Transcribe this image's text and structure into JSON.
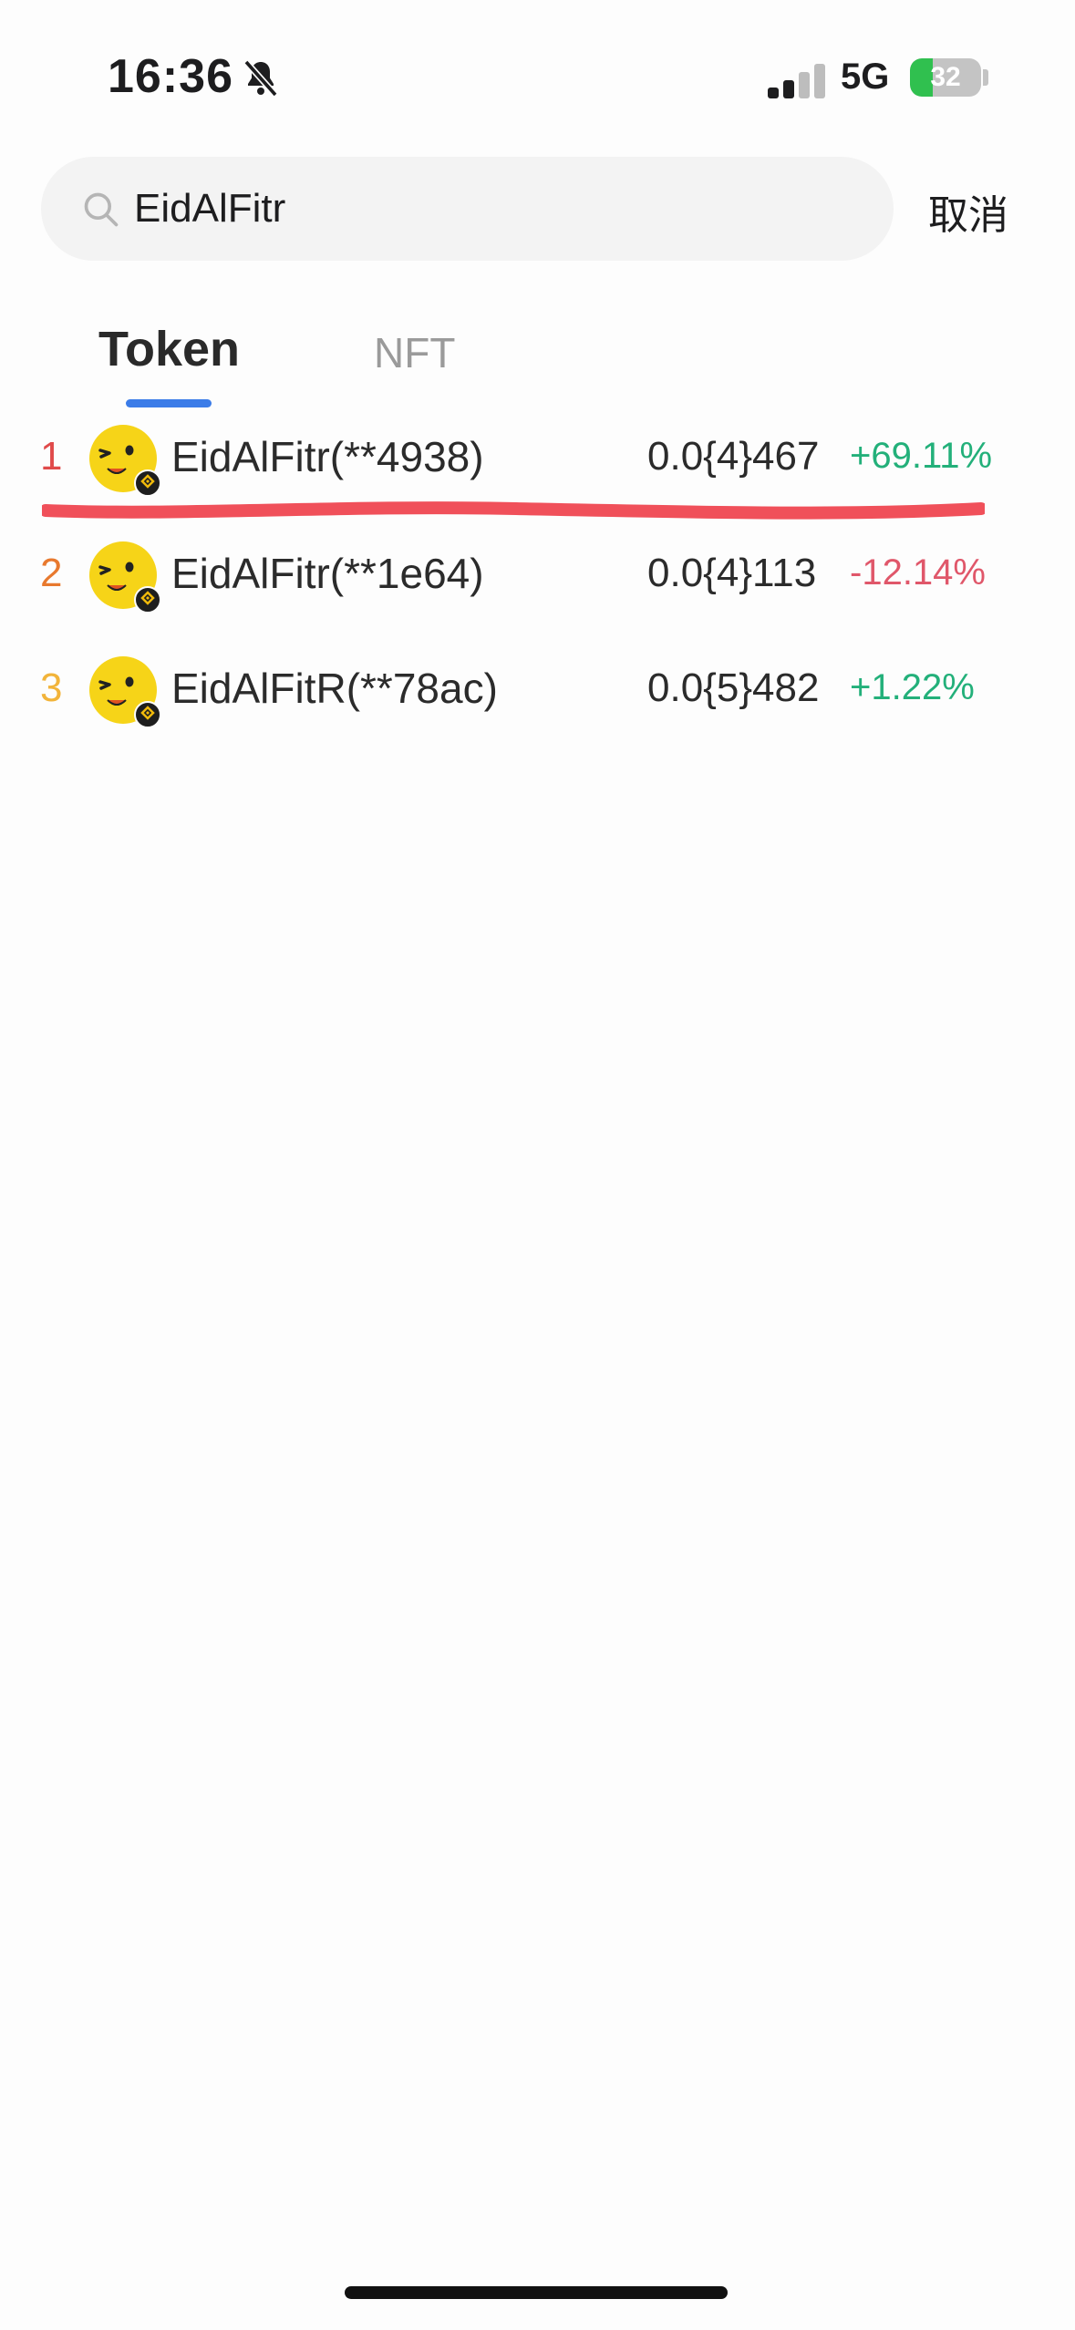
{
  "status_bar": {
    "time": "16:36",
    "network": "5G",
    "battery": "32",
    "battery_level_percent": 32,
    "silent_mode_icon": "bell-slash-icon"
  },
  "search": {
    "value": "EidAlFitr",
    "cancel_label": "取消"
  },
  "tabs": [
    {
      "label": "Token",
      "active": true
    },
    {
      "label": "NFT",
      "active": false
    }
  ],
  "results": [
    {
      "rank": "1",
      "rank_color": "#e04a4a",
      "name": "EidAlFitr(**4938)",
      "price": "0.0{4}467",
      "change": "+69.11%",
      "change_color": "#23b07a",
      "highlighted": true
    },
    {
      "rank": "2",
      "rank_color": "#e8792e",
      "name": "EidAlFitr(**1e64)",
      "price": "0.0{4}113",
      "change": "-12.14%",
      "change_color": "#e0576a",
      "highlighted": false
    },
    {
      "rank": "3",
      "rank_color": "#f2b43a",
      "name": "EidAlFitR(**78ac)",
      "price": "0.0{5}482",
      "change": "+1.22%",
      "change_color": "#23b07a",
      "highlighted": false
    }
  ],
  "icons": {
    "token_avatar": "winking-face-token-icon",
    "chain_badge": "bnb-chain-icon",
    "search": "search-icon"
  },
  "colors": {
    "accent": "#3b7ce8",
    "annotation": "#f0505a"
  }
}
